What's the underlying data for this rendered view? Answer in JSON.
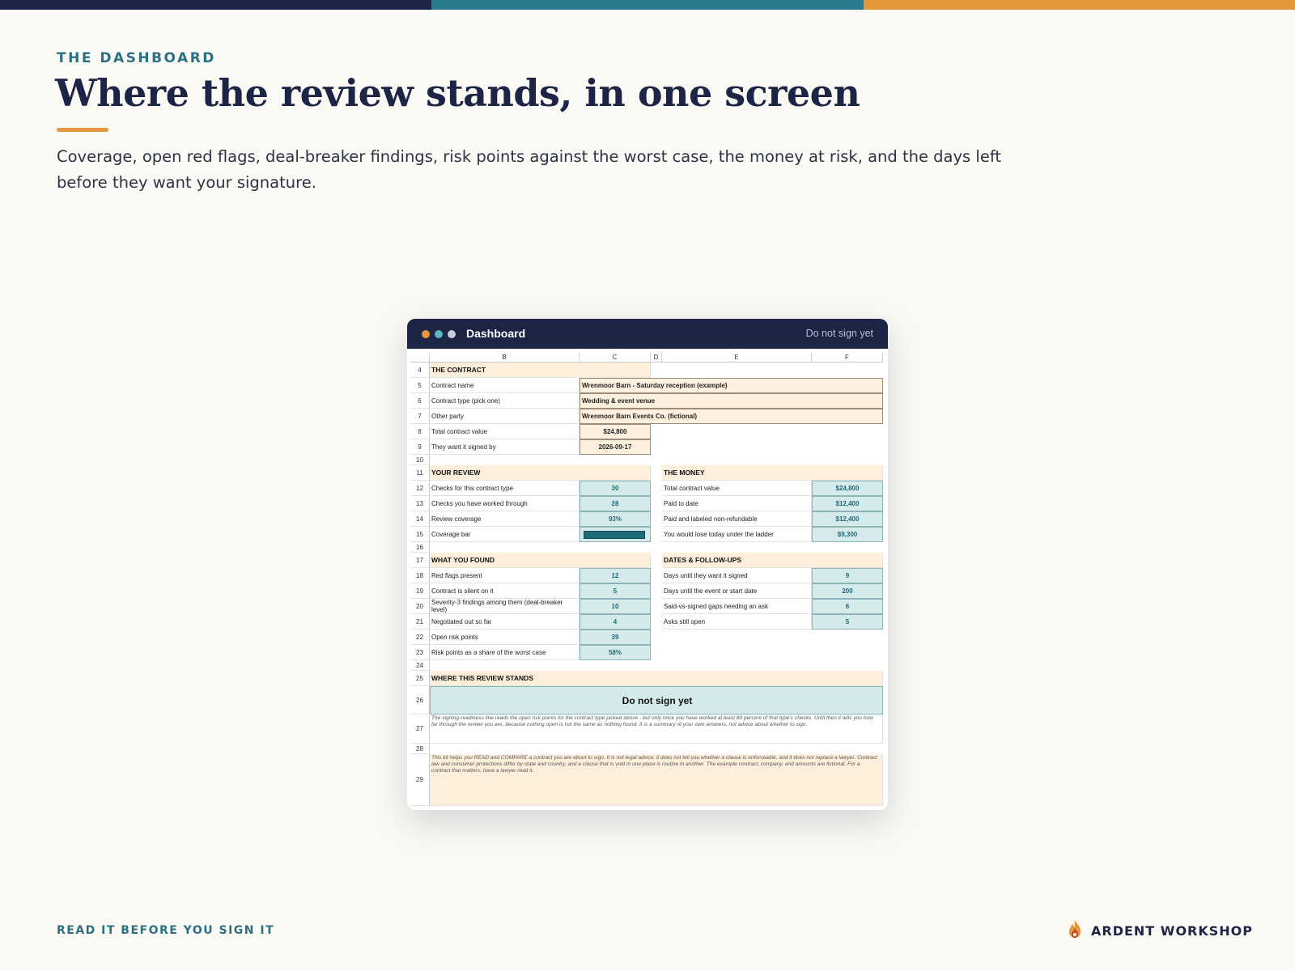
{
  "colors": {
    "navy": "#1c2545",
    "teal": "#2b7183",
    "orange": "#e6973c",
    "cream": "#fbf9f4",
    "input_fill": "#fdf0de",
    "output_fill": "#d4eaeb"
  },
  "slide": {
    "eyebrow": "THE DASHBOARD",
    "title": "Where the review stands, in one screen",
    "subtitle": "Coverage, open red flags, deal-breaker findings, risk points against the worst case, the money at risk, and the days left before they want your signature."
  },
  "window": {
    "title": "Dashboard",
    "status": "Do not sign yet"
  },
  "sheet": {
    "columns": [
      "B",
      "C",
      "D",
      "E",
      "F"
    ],
    "rows": [
      "4",
      "5",
      "6",
      "7",
      "8",
      "9",
      "10",
      "11",
      "12",
      "13",
      "14",
      "15",
      "16",
      "17",
      "18",
      "19",
      "20",
      "21",
      "22",
      "23",
      "24",
      "25",
      "26",
      "27",
      "28",
      "29"
    ],
    "contract": {
      "header": "THE CONTRACT",
      "name_label": "Contract name",
      "name_value": "Wrenmoor Barn - Saturday reception (example)",
      "type_label": "Contract type (pick one)",
      "type_value": "Wedding & event venue",
      "party_label": "Other party",
      "party_value": "Wrenmoor Barn Events Co. (fictional)",
      "value_label": "Total contract value",
      "value_value": "$24,800",
      "signby_label": "They want it signed by",
      "signby_value": "2026-09-17"
    },
    "review": {
      "header": "YOUR REVIEW",
      "checks_label": "Checks for this contract type",
      "checks_value": "30",
      "worked_label": "Checks you have worked through",
      "worked_value": "28",
      "coverage_label": "Review coverage",
      "coverage_value": "93%",
      "bar_label": "Coverage bar",
      "bar_fraction": 0.93
    },
    "money": {
      "header": "THE MONEY",
      "total_label": "Total contract value",
      "total_value": "$24,800",
      "paid_label": "Paid to date",
      "paid_value": "$12,400",
      "nonref_label": "Paid and labeled non-refundable",
      "nonref_value": "$12,400",
      "lose_label": "You would lose today under the ladder",
      "lose_value": "$9,300"
    },
    "found": {
      "header": "WHAT YOU FOUND",
      "flags_label": "Red flags present",
      "flags_value": "12",
      "silent_label": "Contract is silent on it",
      "silent_value": "5",
      "sev3_label": "Severity-3 findings among them (deal-breaker level)",
      "sev3_value": "10",
      "negotiated_label": "Negotiated out so far",
      "negotiated_value": "4",
      "risk_label": "Open risk points",
      "risk_value": "39",
      "share_label": "Risk points as a share of the worst case",
      "share_value": "58%"
    },
    "dates": {
      "header": "DATES & FOLLOW-UPS",
      "days_sign_label": "Days until they want it signed",
      "days_sign_value": "9",
      "days_event_label": "Days until the event or start date",
      "days_event_value": "200",
      "gaps_label": "Said-vs-signed gaps needing an ask",
      "gaps_value": "6",
      "asks_label": "Asks still open",
      "asks_value": "5"
    },
    "stands": {
      "header": "WHERE THIS REVIEW STANDS",
      "verdict": "Do not sign yet",
      "note": "The signing-readiness line reads the open risk points for the contract type picked above - but only once you have worked at least 80 percent of that type's checks. Until then it tells you how far through the review you are, because nothing open is not the same as nothing found. It is a summary of your own answers, not advice about whether to sign.",
      "disclaimer": "This kit helps you READ and COMPARE a contract you are about to sign. It is not legal advice, it does not tell you whether a clause is enforceable, and it does not replace a lawyer. Contract law and consumer protections differ by state and country, and a clause that is void in one place is routine in another. The example contract, company, and amounts are fictional. For a contract that matters, have a lawyer read it."
    }
  },
  "footer": {
    "left": "READ IT BEFORE YOU SIGN IT",
    "brand": "ARDENT WORKSHOP",
    "brand_icon": "flame-icon"
  }
}
